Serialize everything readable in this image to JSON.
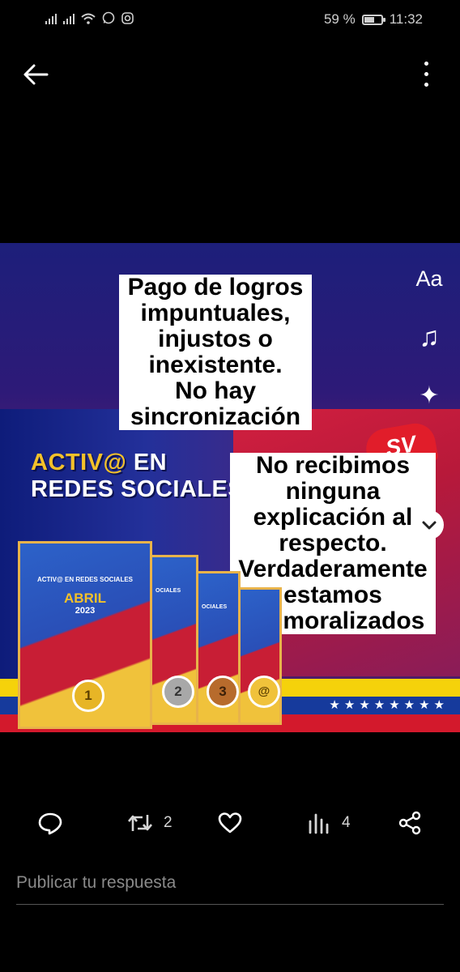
{
  "status_bar": {
    "battery": "59 %",
    "battery_level": 0.59,
    "time": "11:32",
    "icons": [
      "signal-icon",
      "signal-icon",
      "wifi-icon",
      "whatsapp-icon",
      "instagram-icon"
    ]
  },
  "app_bar": {
    "back_icon": "arrow-left-icon",
    "more_icon": "more-vertical-icon"
  },
  "media": {
    "poster_title_line1_accent": "ACTIV@",
    "poster_title_line1_rest": " EN",
    "poster_title_line2": "REDES SOCIALES",
    "book_heading": "ACTIV@ EN REDES SOCIALES",
    "book_month": "ABRIL",
    "book_year": "2023",
    "book_small_heading": "OCIALES",
    "medals": [
      "1",
      "2",
      "3",
      "@"
    ],
    "logo_text": "SV",
    "flag_stars": "★★★★★★★★",
    "bubble_top": [
      "Pago de logros",
      "impuntuales,",
      "injustos o",
      "inexistente.",
      "No hay",
      "sincronización"
    ],
    "bubble_bottom": [
      "No recibimos",
      "ninguna",
      "explicación al",
      "respecto.",
      "Verdaderamente",
      "estamos",
      "desmoralizados"
    ]
  },
  "editor_tools": {
    "text_tool_label": "Aa",
    "music_tool_glyph": "♫",
    "sparkle_tool_glyph": "✦",
    "icons": [
      "text-tool-icon",
      "music-icon",
      "sparkle-icon",
      "chevron-down-icon"
    ]
  },
  "actions": {
    "reply_count": "",
    "retweet_count": "2",
    "like_count": "",
    "views_count": "4"
  },
  "reply_box": {
    "placeholder": "Publicar tu respuesta"
  },
  "colors": {
    "background": "#000000",
    "text_primary": "#ffffff",
    "text_secondary": "#8a8a8a",
    "flag_yellow": "#f5d20b",
    "flag_blue": "#163a9c",
    "flag_red": "#d3192c"
  }
}
